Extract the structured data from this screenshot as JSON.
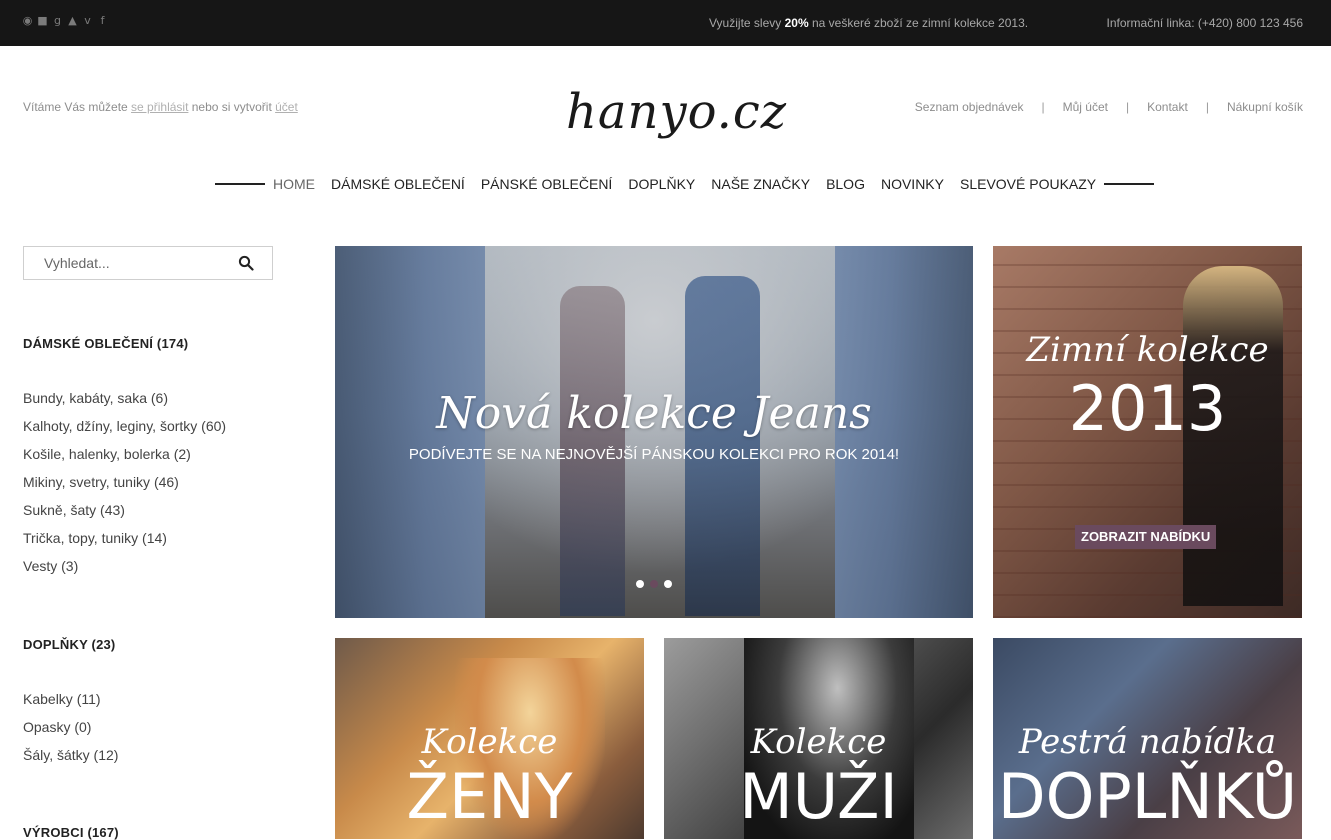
{
  "topbar": {
    "social_icons": [
      "rss-icon",
      "flickr-icon",
      "google-plus-icon",
      "twitter-icon",
      "vimeo-icon",
      "facebook-icon"
    ],
    "promo_before": "Využijte slevy ",
    "promo_discount": "20%",
    "promo_after": " na veškeré zboží ze zimní kolekce 2013.",
    "hotline": "Informační linka: (+420) 800 123 456"
  },
  "header": {
    "welcome_prefix": "Vítáme Vás můžete ",
    "login_link": "se přihlásit",
    "welcome_middle": " nebo si vytvořit ",
    "account_link": "účet",
    "logo": "hanyo.cz",
    "account_links": [
      "Seznam objednávek",
      "Můj účet",
      "Kontakt",
      "Nákupní košík"
    ],
    "separator": "|"
  },
  "nav": {
    "items": [
      "HOME",
      "DÁMSKÉ OBLEČENÍ",
      "PÁNSKÉ OBLEČENÍ",
      "DOPLŇKY",
      "NAŠE ZNAČKY",
      "BLOG",
      "NOVINKY",
      "SLEVOVÉ POUKAZY"
    ],
    "active": "HOME"
  },
  "sidebar": {
    "search_placeholder": "Vyhledat...",
    "categories": [
      {
        "title": "DÁMSKÉ OBLEČENÍ (174)",
        "items": [
          "Bundy, kabáty, saka (6)",
          "Kalhoty, džíny, leginy, šortky (60)",
          "Košile, halenky, bolerka (2)",
          "Mikiny, svetry, tuniky (46)",
          "Sukně, šaty (43)",
          "Trička, topy, tuniky (14)",
          "Vesty (3)"
        ]
      },
      {
        "title": "DOPLŇKY (23)",
        "items": [
          "Kabelky (11)",
          "Opasky (0)",
          "Šály, šátky (12)"
        ]
      },
      {
        "title": "VÝROBCI (167)",
        "items": []
      }
    ]
  },
  "banners": {
    "main": {
      "script": "Nová kolekce Jeans",
      "subtitle": "PODÍVEJTE SE NA NEJNOVĚJŠÍ PÁNSKOU KOLEKCI PRO ROK 2014!",
      "slides": 3,
      "active_slide": 2
    },
    "zimni": {
      "script": "Zimní kolekce",
      "year": "2013",
      "button": "ZOBRAZIT NABÍDKU"
    },
    "zeny": {
      "script": "Kolekce",
      "big": "ŽENY"
    },
    "muzi": {
      "script": "Kolekce",
      "big": "MUŽI"
    },
    "doplnky": {
      "script": "Pestrá nabídka",
      "big": "DOPLŇKŮ"
    }
  },
  "colors": {
    "accent": "#6a4a5e",
    "topbar": "#161616"
  }
}
